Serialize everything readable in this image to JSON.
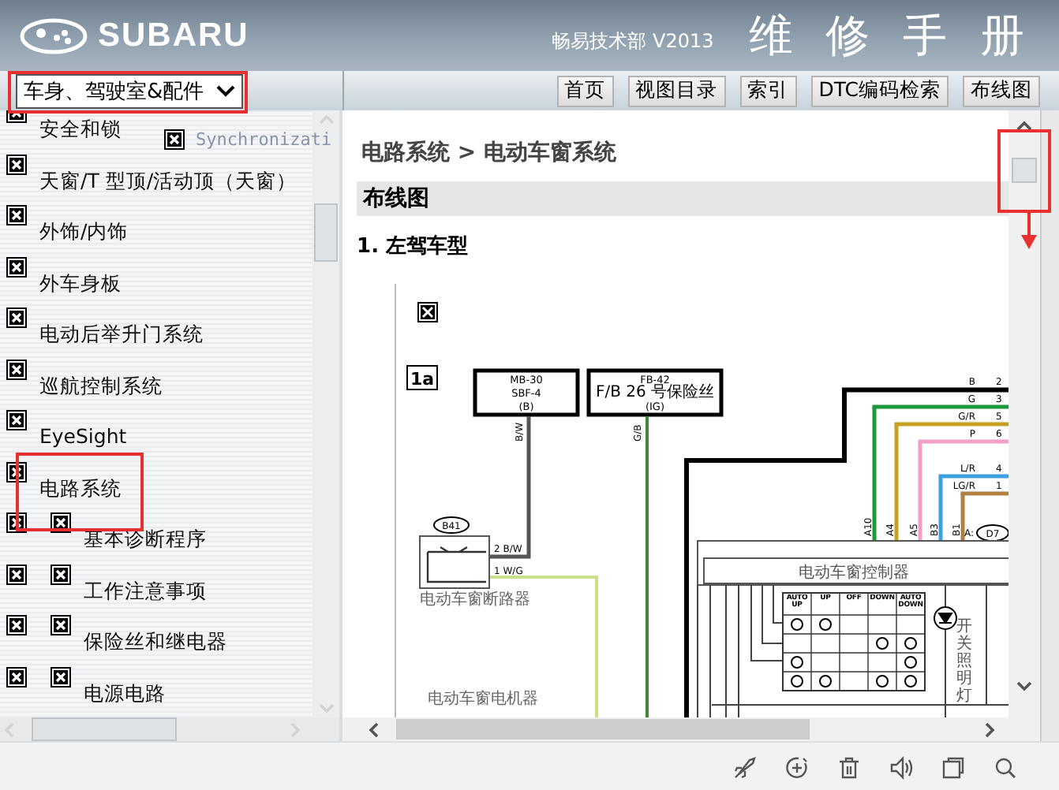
{
  "header": {
    "brand": "SUBARU",
    "publisher": "畅易技术部 V2013",
    "title": "维 修 手 册"
  },
  "toolbar": {
    "category_select": {
      "value": "车身、驾驶室&配件"
    },
    "buttons": [
      "首页",
      "视图目录",
      "索引",
      "DTC编码检索",
      "布线图"
    ]
  },
  "sidebar": {
    "overlay_text": "Synchronizati",
    "items": [
      {
        "label": "安全和锁"
      },
      {
        "label": "天窗/T 型顶/活动顶（天窗）"
      },
      {
        "label": "外饰/内饰"
      },
      {
        "label": "外车身板"
      },
      {
        "label": "电动后举升门系统"
      },
      {
        "label": "巡航控制系统"
      },
      {
        "label": "EyeSight"
      },
      {
        "label": "电路系统",
        "children": [
          {
            "label": "基本诊断程序"
          },
          {
            "label": "工作注意事项"
          },
          {
            "label": "保险丝和继电器"
          },
          {
            "label": "电源电路"
          }
        ]
      }
    ]
  },
  "content": {
    "breadcrumb": "电路系统 > 电动车窗系统",
    "section": "布线图",
    "heading": "1. 左驾车型",
    "diagram": {
      "section_id": "1a",
      "fuse_boxes": [
        {
          "lines": [
            "MB-30",
            "SBF-4",
            "(B)"
          ]
        },
        {
          "lines": [
            "FB-42",
            "F/B 26 号保险丝",
            "(IG)"
          ]
        }
      ],
      "fuse_wires": [
        "B/W",
        "G/B"
      ],
      "breaker": {
        "connector": "B41",
        "pins": [
          {
            "pin": "2",
            "wire": "B/W"
          },
          {
            "pin": "1",
            "wire": "W/G"
          }
        ],
        "name": "电动车窗断路器"
      },
      "harness": [
        {
          "wire": "B",
          "pin": "2",
          "color": "#000000"
        },
        {
          "wire": "G",
          "pin": "3",
          "color": "#1a9a3a"
        },
        {
          "wire": "G/R",
          "pin": "5",
          "color": "#c8a020"
        },
        {
          "wire": "P",
          "pin": "6",
          "color": "#f0a0c8"
        },
        {
          "wire": "L/R",
          "pin": "4",
          "color": "#3aa0e0"
        },
        {
          "wire": "LG/R",
          "pin": "1",
          "color": "#b08040"
        }
      ],
      "controller": {
        "pins": [
          "A10",
          "A4",
          "A5",
          "B3",
          "B1"
        ],
        "connector_prefix": "A:",
        "connector": "D7",
        "name": "电动车窗控制器",
        "switch_positions": [
          "AUTO UP",
          "UP",
          "OFF",
          "DOWN",
          "AUTO DOWN"
        ],
        "lamp": "开关照明灯"
      },
      "motor_label": "电动车窗电机器"
    }
  }
}
